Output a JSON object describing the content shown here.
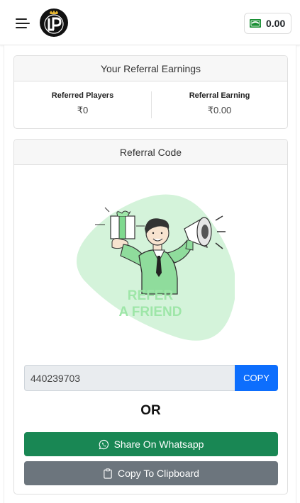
{
  "header": {
    "logo_text": "LP",
    "wallet_amount": "0.00"
  },
  "earnings": {
    "title": "Your Referral Earnings",
    "referred_players_label": "Referred Players",
    "referred_players_value": "₹0",
    "referral_earning_label": "Referral Earning",
    "referral_earning_value": "₹0.00"
  },
  "referral": {
    "title": "Referral Code",
    "illustration_line1": "REFER",
    "illustration_line2": "A FRIEND",
    "code_value": "440239703",
    "copy_label": "COPY",
    "or_text": "OR",
    "whatsapp_label": "Share On Whatsapp",
    "clipboard_label": "Copy To Clipboard"
  },
  "colors": {
    "primary": "#0d6efd",
    "success": "#198754",
    "secondary": "#6c757d",
    "illustration_green": "#9ee6a8"
  }
}
